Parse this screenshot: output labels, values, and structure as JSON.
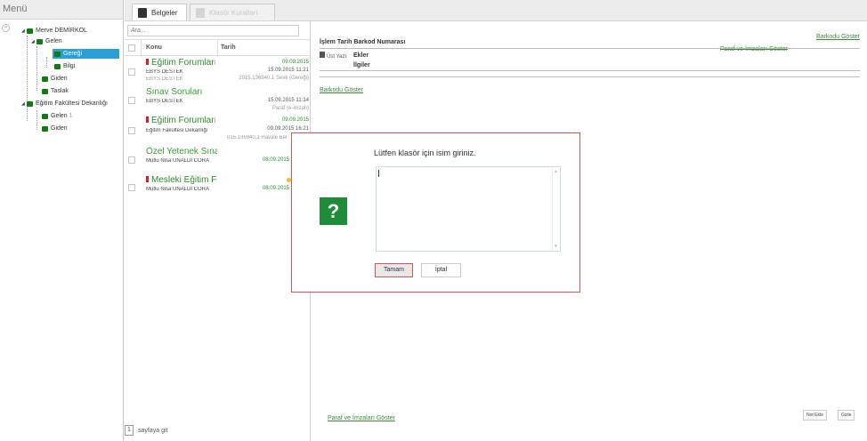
{
  "menu": {
    "title": "Menü",
    "collapse_glyph": "«",
    "tree": {
      "user": "Merve DEMİRKOL",
      "gelen": "Gelen",
      "geregi": "Gereği",
      "bilgi": "Bilgi",
      "giden": "Giden",
      "taslak": "Taslak",
      "fakulte": "Eğitim Fakültesi Dekanlığı",
      "fak_gelen": "Gelen",
      "fak_gelen_count": "1",
      "fak_giden": "Giden"
    }
  },
  "tabs": {
    "belgeler": "Belgeler",
    "klasor": "Klasör Kuralları"
  },
  "list": {
    "search_placeholder": "Ara...",
    "col_konu": "Konu",
    "col_tarih": "Tarih",
    "items": [
      {
        "title": "Eğitim Forumları",
        "from": "EBYS DESTEK",
        "from2": "EBYS DESTEK",
        "date1": "09.09.2015",
        "date2": "15.09.2015 11:21",
        "extra": "2015.136940.1 Sevk (Gereği)"
      },
      {
        "title": "Sınav Soruları",
        "from": "EBYS DESTEK",
        "date1": "15.09.2015 11:14",
        "extra": "Paraf (e-imzalı)"
      },
      {
        "title": "Eğitim Forumları",
        "from": "Eğitim Fakültesi Dekanlığı",
        "date1": "09.09.2015",
        "date2": "09.09.2015 16:21",
        "extra": "015.136940.1 Havale Bel"
      },
      {
        "title": "Özel Yetenek Sınavlı",
        "from": "Mutlu Nisa ÜNALDI CORA",
        "date1": "08.09.2015"
      },
      {
        "title": "Mesleki Eğitim For",
        "from": "Mutlu Nisa ÜNALDI CORA",
        "date1": "08.09.2015"
      }
    ],
    "page_num": "1",
    "page_label": "sayfaya git"
  },
  "detail": {
    "barkodu_goster_top": "Barkodu Göster",
    "header": "İşlem Tarih Barkod Numarası",
    "paraf_top": "Paraf ve İmzaları Göster",
    "ust_yazi": "Üst Yazı",
    "ekler": "Ekler",
    "ilgiler": "İlgiler",
    "barkodu_goster": "Barkodu Göster",
    "paraf_bottom": "Paraf ve İmzaları Göster",
    "not_ekle": "Not Ekle",
    "gizle": "Gizle"
  },
  "modal": {
    "icon_glyph": "?",
    "message": "Lütfen klasör için isim giriniz.",
    "input_value": "",
    "ok_label": "Tamam",
    "cancel_label": "İptal",
    "border_color": "#d9534f",
    "icon_color": "#1e8c39"
  }
}
